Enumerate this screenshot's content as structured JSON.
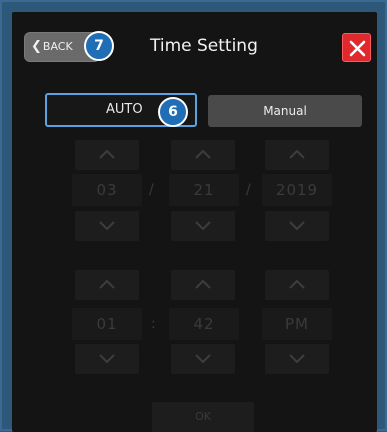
{
  "header": {
    "back_label": "BACK",
    "back_badge": "7",
    "title": "Time Setting"
  },
  "mode": {
    "auto_label": "AUTO",
    "auto_badge": "6",
    "manual_label": "Manual",
    "selected": "AUTO"
  },
  "date": {
    "month": "03",
    "day": "21",
    "year": "2019",
    "separator": "/"
  },
  "time": {
    "hour": "01",
    "minute": "42",
    "period": "PM",
    "separator": ":"
  },
  "ok_label": "OK",
  "colors": {
    "accent": "#5aa3e0",
    "badge": "#1f6eb6",
    "close": "#e0282f",
    "frame": "#2d5879"
  }
}
